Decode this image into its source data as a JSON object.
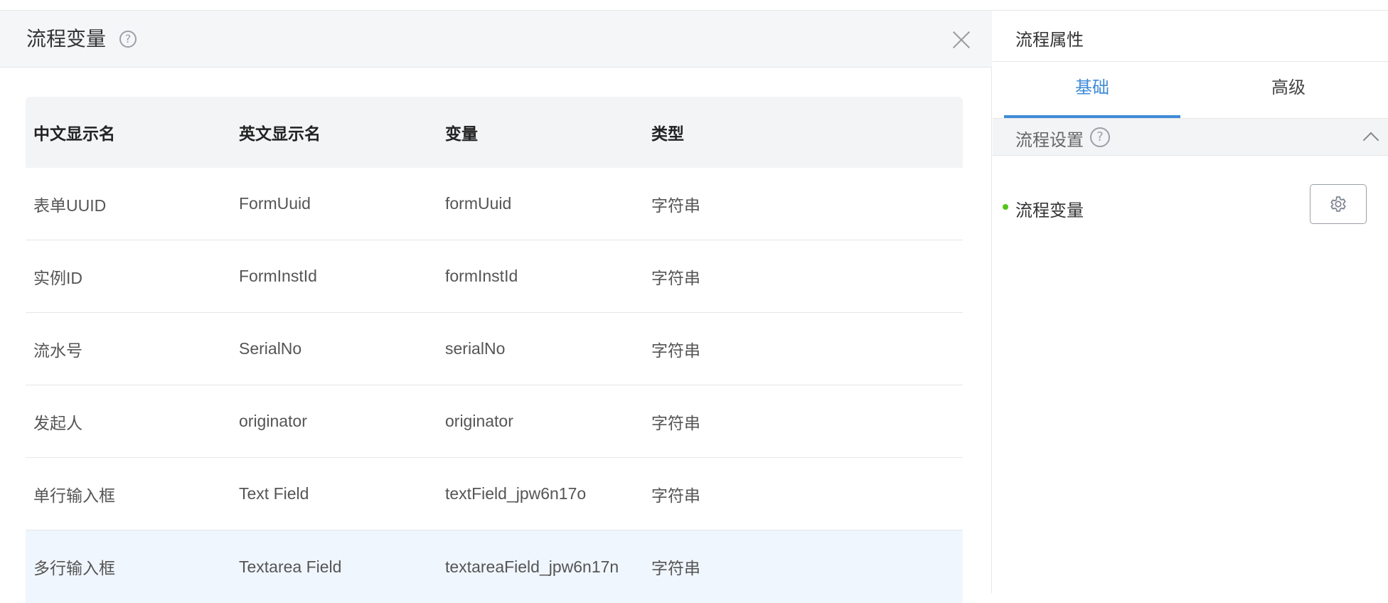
{
  "dialog": {
    "title": "流程变量",
    "help_glyph": "?",
    "close_icon": "close-icon",
    "columns": [
      "中文显示名",
      "英文显示名",
      "变量",
      "类型"
    ],
    "rows": [
      [
        "表单UUID",
        "FormUuid",
        "formUuid",
        "字符串"
      ],
      [
        "实例ID",
        "FormInstId",
        "formInstId",
        "字符串"
      ],
      [
        "流水号",
        "SerialNo",
        "serialNo",
        "字符串"
      ],
      [
        "发起人",
        "originator",
        "originator",
        "字符串"
      ],
      [
        "单行输入框",
        "Text Field",
        "textField_jpw6n17o",
        "字符串"
      ],
      [
        "多行输入框",
        "Textarea Field",
        "textareaField_jpw6n17n",
        "字符串"
      ]
    ]
  },
  "panel": {
    "title": "流程属性",
    "tabs": [
      {
        "label": "基础",
        "active": true
      },
      {
        "label": "高级",
        "active": false
      }
    ],
    "section": {
      "label": "流程设置",
      "help_glyph": "?"
    },
    "property": {
      "label": "流程变量",
      "button_icon": "gear-icon"
    }
  },
  "colors": {
    "accent": "#3f8bd8",
    "status_dot": "#52c41a",
    "header_bg": "#f5f6f8",
    "row_highlight": "#f0f6fd"
  }
}
